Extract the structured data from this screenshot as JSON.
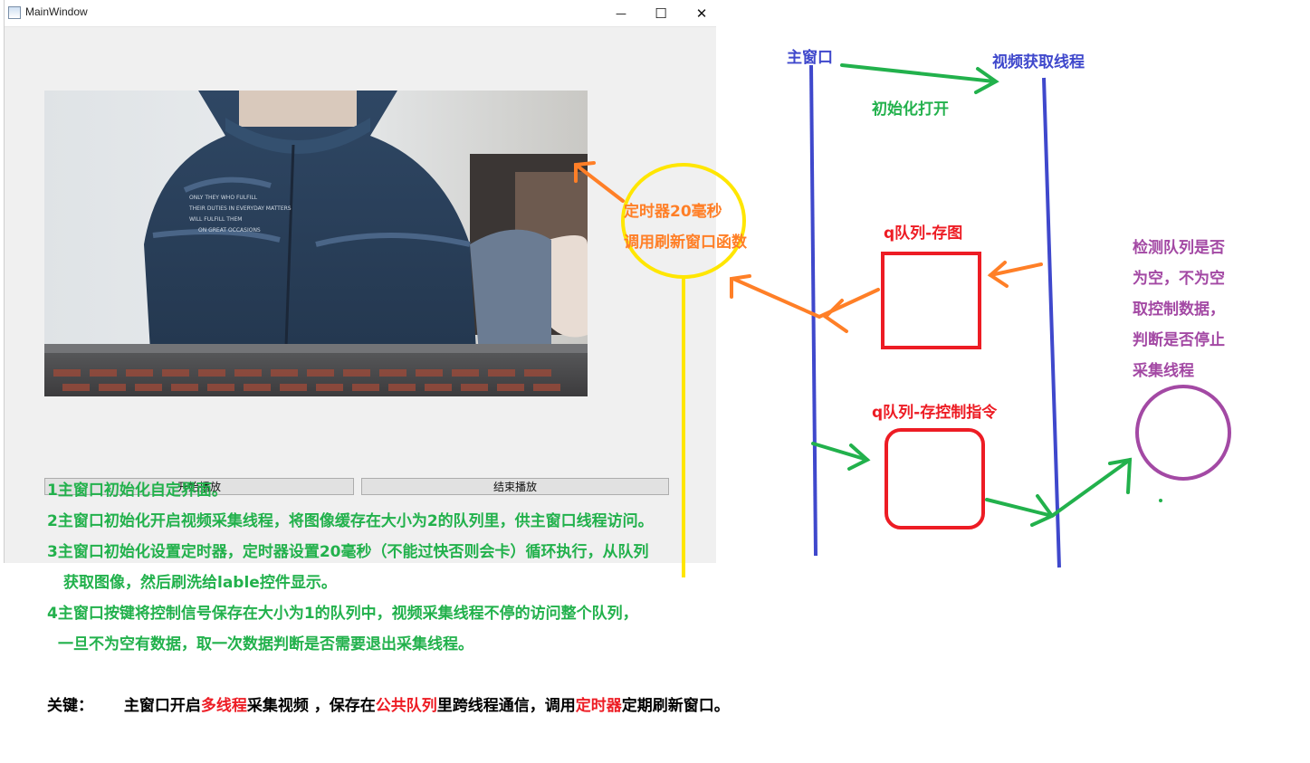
{
  "window": {
    "title": "MainWindow",
    "minimize_glyph": "—",
    "maximize_glyph": "☐",
    "close_glyph": "✕"
  },
  "buttons": {
    "start_label": "开始播放",
    "stop_label": "结束播放"
  },
  "notes": {
    "line1": "1主窗口初始化自定界面。",
    "line2": "2主窗口初始化开启视频采集线程，将图像缓存在大小为2的队列里，供主窗口线程访问。",
    "line3": "3主窗口初始化设置定时器，定时器设置20毫秒（不能过快否则会卡）循环执行，从队列",
    "line3b": "获取图像，然后刷洗给lable控件显示。",
    "line4": "4主窗口按键将控制信号保存在大小为1的队列中，视频采集线程不停的访问整个队列，",
    "line4b": "一旦不为空有数据，取一次数据判断是否需要退出采集线程。"
  },
  "key_line": {
    "label": "关键：",
    "part1": "主窗口开启",
    "highlight1": "多线程",
    "part2": "采集视频 ，保存在",
    "highlight2": "公共队列",
    "part3": "里跨线程通信，调用",
    "highlight3": "定时器",
    "part4": "定期刷新窗口。"
  },
  "diagram": {
    "main_window": "主窗口",
    "video_thread": "视频获取线程",
    "init_open": "初始化打开",
    "timer_line1": "定时器20毫秒",
    "timer_line2": "调用刷新窗口函数",
    "queue_image": "q队列-存图",
    "queue_control": "q队列-存控制指令",
    "check_lines": [
      "检测队列是否",
      "为空，不为空",
      "取控制数据，",
      "判断是否停止",
      "采集线程"
    ]
  },
  "colors": {
    "blue": "#3f48cc",
    "green": "#22b14c",
    "orange": "#ff7f27",
    "red": "#ed1c24",
    "yellow": "#ffe600",
    "purple": "#a349a4"
  }
}
